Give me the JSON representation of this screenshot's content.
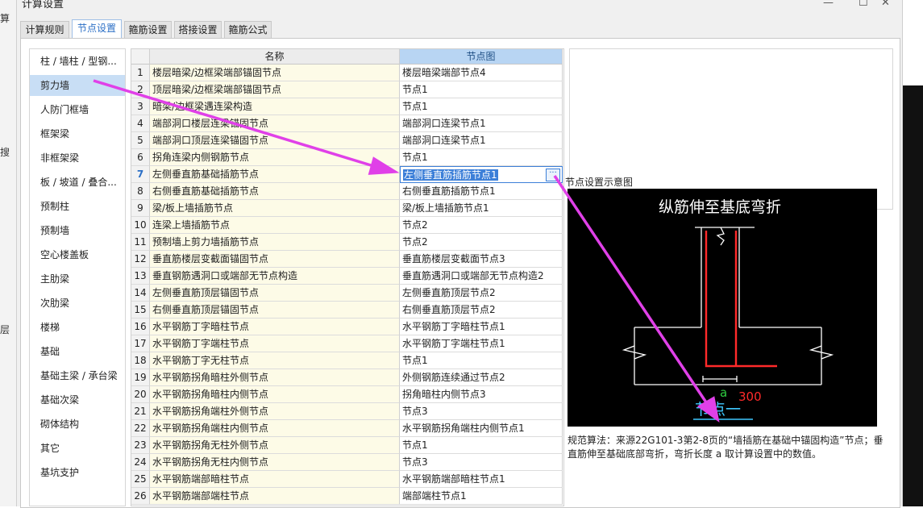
{
  "background": {
    "fragments": [
      "算",
      "搜",
      "层"
    ]
  },
  "window": {
    "title": "计算设置",
    "minimize": "—",
    "maximize": "☐",
    "close": "✕"
  },
  "tabs": [
    "计算规则",
    "节点设置",
    "箍筋设置",
    "搭接设置",
    "箍筋公式"
  ],
  "active_tab": 1,
  "categories": [
    "柱 / 墙柱 / 型钢...",
    "剪力墙",
    "人防门框墙",
    "框架梁",
    "非框架梁",
    "板 / 坡道 / 叠合...",
    "预制柱",
    "预制墙",
    "空心楼盖板",
    "主肋梁",
    "次肋梁",
    "楼梯",
    "基础",
    "基础主梁 / 承台梁",
    "基础次梁",
    "砌体结构",
    "其它",
    "基坑支护"
  ],
  "selected_category": 1,
  "grid": {
    "col_name": "名称",
    "col_node": "节点图",
    "current_row": 7,
    "ellipsis": "···",
    "rows": [
      {
        "n": "1",
        "name": "楼层暗梁/边框梁端部锚固节点",
        "node": "楼层暗梁端部节点4"
      },
      {
        "n": "2",
        "name": "顶层暗梁/边框梁端部锚固节点",
        "node": "节点1"
      },
      {
        "n": "3",
        "name": "暗梁/边框梁遇连梁构造",
        "node": "节点1"
      },
      {
        "n": "4",
        "name": "端部洞口楼层连梁锚固节点",
        "node": "端部洞口连梁节点1"
      },
      {
        "n": "5",
        "name": "端部洞口顶层连梁锚固节点",
        "node": "端部洞口连梁节点1"
      },
      {
        "n": "6",
        "name": "拐角连梁内侧钢筋节点",
        "node": "节点1"
      },
      {
        "n": "7",
        "name": "左侧垂直筋基础插筋节点",
        "node": "左侧垂直筋插筋节点1"
      },
      {
        "n": "8",
        "name": "右侧垂直筋基础插筋节点",
        "node": "右侧垂直筋插筋节点1"
      },
      {
        "n": "9",
        "name": "梁/板上墙插筋节点",
        "node": "梁/板上墙插筋节点1"
      },
      {
        "n": "10",
        "name": "连梁上墙插筋节点",
        "node": "节点2"
      },
      {
        "n": "11",
        "name": "预制墙上剪力墙插筋节点",
        "node": "节点2"
      },
      {
        "n": "12",
        "name": "垂直筋楼层变截面锚固节点",
        "node": "垂直筋楼层变截面节点3"
      },
      {
        "n": "13",
        "name": "垂直钢筋遇洞口或端部无节点构造",
        "node": "垂直筋遇洞口或端部无节点构造2"
      },
      {
        "n": "14",
        "name": "左侧垂直筋顶层锚固节点",
        "node": "左侧垂直筋顶层节点2"
      },
      {
        "n": "15",
        "name": "右侧垂直筋顶层锚固节点",
        "node": "右侧垂直筋顶层节点2"
      },
      {
        "n": "16",
        "name": "水平钢筋丁字暗柱节点",
        "node": "水平钢筋丁字暗柱节点1"
      },
      {
        "n": "17",
        "name": "水平钢筋丁字端柱节点",
        "node": "水平钢筋丁字端柱节点1"
      },
      {
        "n": "18",
        "name": "水平钢筋丁字无柱节点",
        "node": "节点1"
      },
      {
        "n": "19",
        "name": "水平钢筋拐角暗柱外侧节点",
        "node": "外侧钢筋连续通过节点2"
      },
      {
        "n": "20",
        "name": "水平钢筋拐角暗柱内侧节点",
        "node": "拐角暗柱内侧节点3"
      },
      {
        "n": "21",
        "name": "水平钢筋拐角端柱外侧节点",
        "node": "节点3"
      },
      {
        "n": "22",
        "name": "水平钢筋拐角端柱内侧节点",
        "node": "水平钢筋拐角端柱内侧节点1"
      },
      {
        "n": "23",
        "name": "水平钢筋拐角无柱外侧节点",
        "node": "节点1"
      },
      {
        "n": "24",
        "name": "水平钢筋拐角无柱内侧节点",
        "node": "节点3"
      },
      {
        "n": "25",
        "name": "水平钢筋端部暗柱节点",
        "node": "水平钢筋端部暗柱节点1"
      },
      {
        "n": "26",
        "name": "水平钢筋端部端柱节点",
        "node": "端部端柱节点1"
      }
    ]
  },
  "diagram": {
    "panel_title": "节点设置示意图",
    "heading": "纵筋伸至基底弯折",
    "label_a": "a",
    "label_300": "300",
    "caption": "节点一",
    "colors": {
      "bg": "#000000",
      "wall": "#ffffff",
      "rebar": "#ff2a2a",
      "label_a": "#2ecc40",
      "label_300": "#ff2a2a",
      "caption": "#3fc8ff"
    }
  },
  "note": "规范算法：来源22G101-3第2-8页的“墙插筋在基础中锚固构造”节点；垂直筋伸至基础底部弯折，弯折长度 a 取计算设置中的数值。",
  "annotation_color": "#e040e8"
}
